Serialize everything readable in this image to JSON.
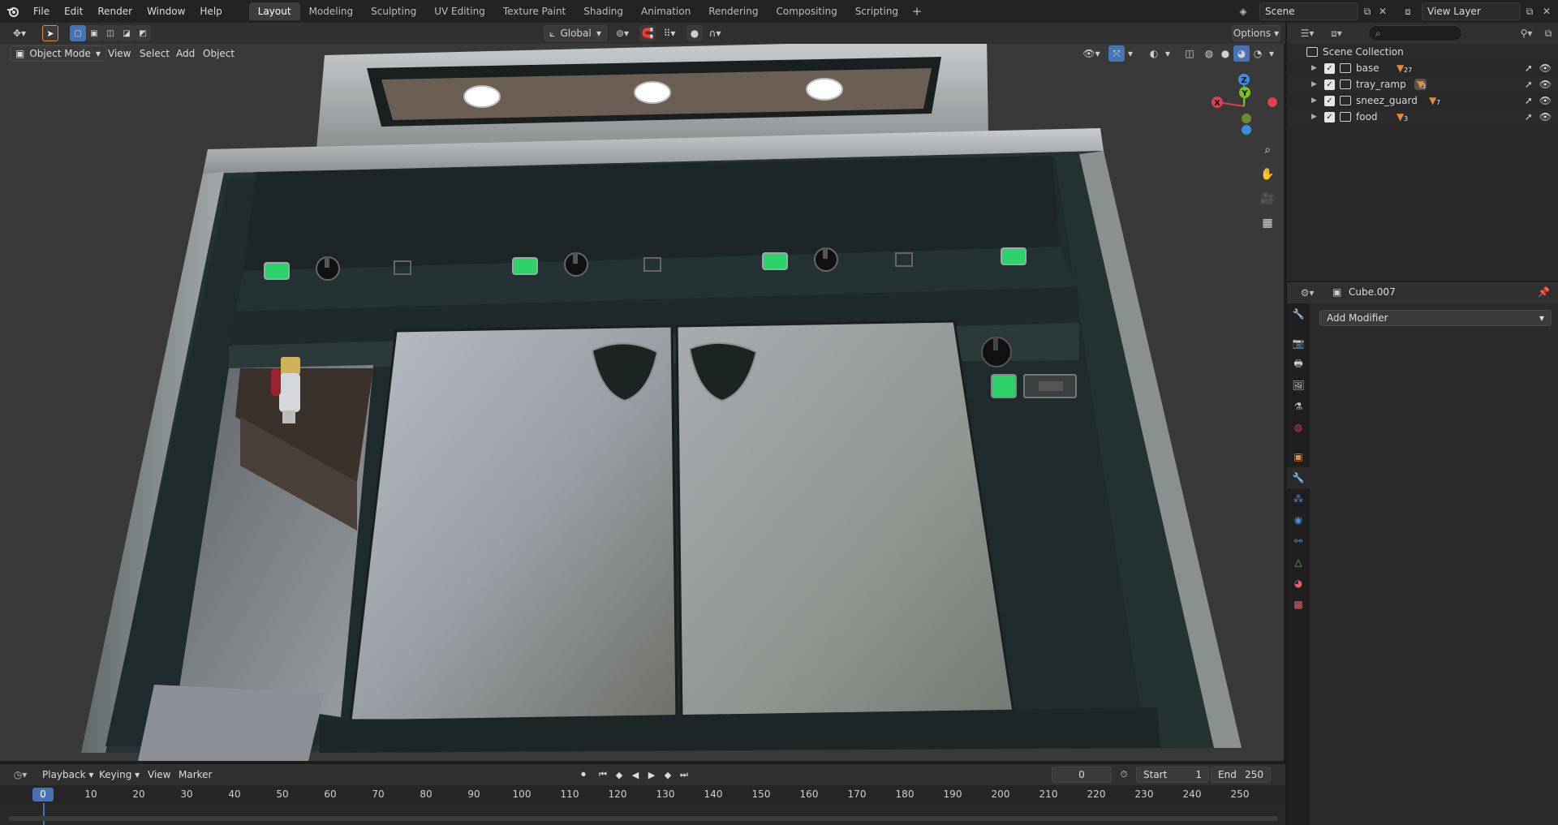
{
  "topbar": {
    "menus": [
      "File",
      "Edit",
      "Render",
      "Window",
      "Help"
    ],
    "workspaces": [
      "Layout",
      "Modeling",
      "Sculpting",
      "UV Editing",
      "Texture Paint",
      "Shading",
      "Animation",
      "Rendering",
      "Compositing",
      "Scripting"
    ],
    "active_workspace": "Layout",
    "scene_name": "Scene",
    "view_layer": "View Layer"
  },
  "viewport_header": {
    "transform_orientation": "Global",
    "options_label": "Options",
    "mode": "Object Mode",
    "menus": [
      "View",
      "Select",
      "Add",
      "Object"
    ]
  },
  "gizmo": {
    "x_label": "X",
    "y_label": "Y",
    "z_label": "Z",
    "x_color": "#e0404f",
    "y_color": "#7fbf20",
    "z_color": "#3f8be0"
  },
  "outliner": {
    "root": "Scene Collection",
    "search_placeholder": "",
    "items": [
      {
        "name": "base",
        "badge": "27"
      },
      {
        "name": "tray_ramp",
        "badge": "3"
      },
      {
        "name": "sneez_guard",
        "badge": "7"
      },
      {
        "name": "food",
        "badge": "3"
      }
    ]
  },
  "properties": {
    "object_name": "Cube.007",
    "add_modifier": "Add Modifier"
  },
  "timeline": {
    "menus": [
      "Playback",
      "Keying",
      "View",
      "Marker"
    ],
    "current_frame": "0",
    "start_label": "Start",
    "start_value": "1",
    "end_label": "End",
    "end_value": "250",
    "ruler_labels": [
      "0",
      "10",
      "20",
      "30",
      "40",
      "50",
      "60",
      "70",
      "80",
      "90",
      "100",
      "110",
      "120",
      "130",
      "140",
      "150",
      "160",
      "170",
      "180",
      "190",
      "200",
      "210",
      "220",
      "230",
      "240",
      "250"
    ],
    "ruler_current": "0"
  },
  "colors": {
    "accent": "#4772b3",
    "object_orange": "#e38b38",
    "panel_green": "#2bd36a"
  }
}
